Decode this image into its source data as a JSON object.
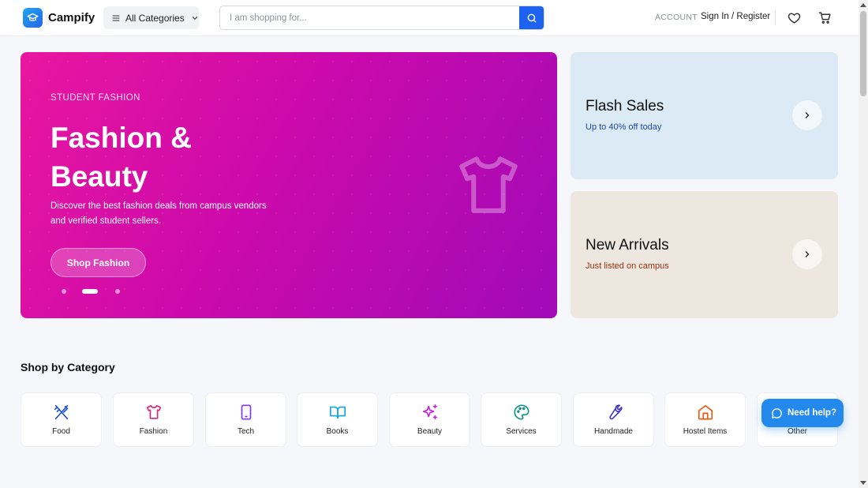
{
  "header": {
    "brand": "Campify",
    "categories_label": "All Categories",
    "search_placeholder": "I am shopping for...",
    "account_label": "ACCOUNT",
    "signin_label": "Sign In / Register"
  },
  "hero": {
    "kicker": "STUDENT FASHION",
    "title": "Fashion & Beauty",
    "description": "Discover the best fashion deals from campus vendors and verified student sellers.",
    "cta": "Shop Fashion",
    "slide_count": 3,
    "active_slide": 2
  },
  "promos": [
    {
      "title": "Flash Sales",
      "subtitle": "Up to 40% off today"
    },
    {
      "title": "New Arrivals",
      "subtitle": "Just listed on campus"
    }
  ],
  "categories": {
    "title": "Shop by Category",
    "items": [
      {
        "label": "Food",
        "icon": "utensils-icon",
        "color": "#1d4ed8"
      },
      {
        "label": "Fashion",
        "icon": "shirt-icon",
        "color": "#db2777"
      },
      {
        "label": "Tech",
        "icon": "tablet-icon",
        "color": "#7c3aed"
      },
      {
        "label": "Books",
        "icon": "book-open-icon",
        "color": "#0ea5e9"
      },
      {
        "label": "Beauty",
        "icon": "sparkles-icon",
        "color": "#c026d3"
      },
      {
        "label": "Services",
        "icon": "palette-icon",
        "color": "#0d9488"
      },
      {
        "label": "Handmade",
        "icon": "wrench-icon",
        "color": "#4338ca"
      },
      {
        "label": "Hostel Items",
        "icon": "home-icon",
        "color": "#ea580c"
      },
      {
        "label": "Other",
        "icon": "grid-icon",
        "color": "#16a34a"
      }
    ]
  },
  "help": {
    "label": "Need help?"
  },
  "colors": {
    "primary": "#1d63f0",
    "hero_start": "#e9169f",
    "hero_end": "#a10ab8",
    "flash_bg": "#dbeaf4",
    "arrivals_bg": "#ede7e0"
  }
}
